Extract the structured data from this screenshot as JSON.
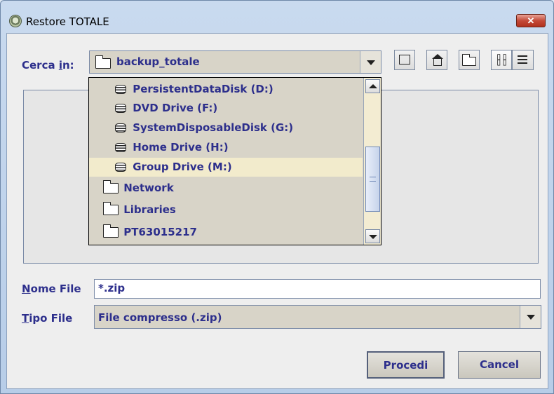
{
  "window": {
    "title": "Restore TOTALE",
    "close_glyph": "✕"
  },
  "look_in": {
    "label_pre": "Cerca ",
    "label_mn": "i",
    "label_post": "n:",
    "value": "backup_totale"
  },
  "toolbar": {
    "buttons": [
      "up-one-level-icon",
      "home-icon",
      "new-folder-icon",
      "list-view-icon",
      "details-view-icon"
    ]
  },
  "dropdown": {
    "items": [
      {
        "label": "PersistentDataDisk (D:)",
        "icon": "drive-icon",
        "indent": true,
        "selected": false
      },
      {
        "label": "DVD Drive (F:)",
        "icon": "drive-icon",
        "indent": true,
        "selected": false
      },
      {
        "label": "SystemDisposableDisk (G:)",
        "icon": "drive-icon",
        "indent": true,
        "selected": false
      },
      {
        "label": "Home Drive (H:)",
        "icon": "drive-icon",
        "indent": true,
        "selected": false
      },
      {
        "label": "Group Drive (M:)",
        "icon": "drive-icon",
        "indent": true,
        "selected": true
      },
      {
        "label": "Network",
        "icon": "folder-icon",
        "indent": false,
        "selected": false
      },
      {
        "label": "Libraries",
        "icon": "folder-icon",
        "indent": false,
        "selected": false
      },
      {
        "label": "PT63015217",
        "icon": "folder-icon",
        "indent": false,
        "selected": false
      }
    ]
  },
  "file_name": {
    "label_mn": "N",
    "label_rest": "ome File",
    "value": "*.zip"
  },
  "file_type": {
    "label_mn": "T",
    "label_rest": "ipo File",
    "value": "File compresso (.zip)"
  },
  "buttons": {
    "proceed": "Procedi",
    "cancel": "Cancel"
  },
  "colors": {
    "label_text": "#2d2f8c",
    "selection": "#f2ebcc",
    "title_bar": "#c9daef",
    "close_button": "#c44a38"
  }
}
